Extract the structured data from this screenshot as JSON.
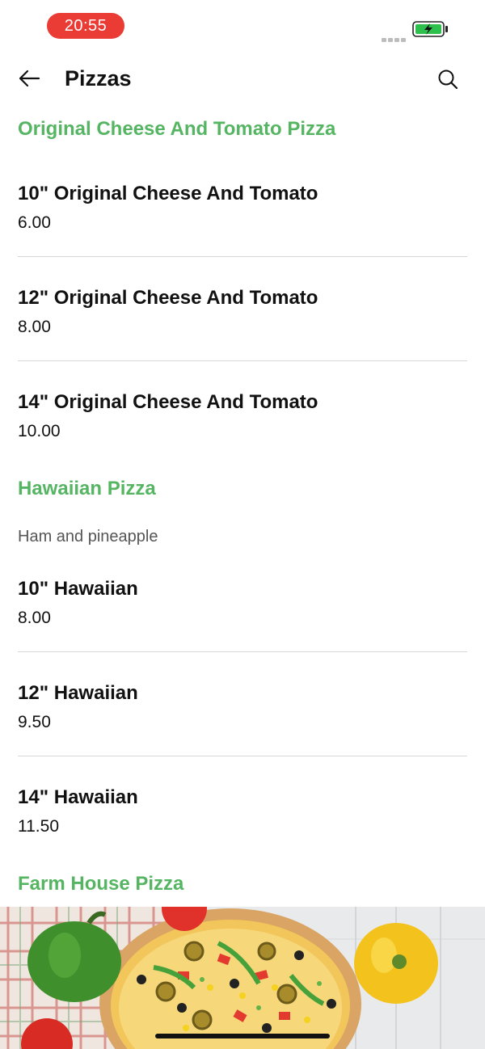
{
  "status_bar": {
    "time": "20:55",
    "time_pill_color": "#ea3b35",
    "battery_icon": "battery-charging-icon",
    "battery_color": "#2ec04d"
  },
  "header": {
    "title": "Pizzas",
    "back_icon": "arrow-left-icon",
    "search_icon": "search-icon"
  },
  "accent_color": "#55b562",
  "sections": [
    {
      "title": "Original Cheese And Tomato Pizza",
      "items": [
        {
          "name": "10\" Original Cheese And Tomato",
          "price": "6.00"
        },
        {
          "name": "12\" Original Cheese And Tomato",
          "price": "8.00"
        },
        {
          "name": "14\" Original Cheese And Tomato",
          "price": "10.00"
        }
      ]
    },
    {
      "title": "Hawaiian Pizza",
      "description": "Ham and pineapple",
      "items": [
        {
          "name": "10\" Hawaiian",
          "price": "8.00"
        },
        {
          "name": "12\" Hawaiian",
          "price": "9.50"
        },
        {
          "name": "14\" Hawaiian",
          "price": "11.50"
        }
      ]
    },
    {
      "title": "Farm House Pizza"
    }
  ],
  "banner": {
    "image": "pizza-banner-image"
  }
}
